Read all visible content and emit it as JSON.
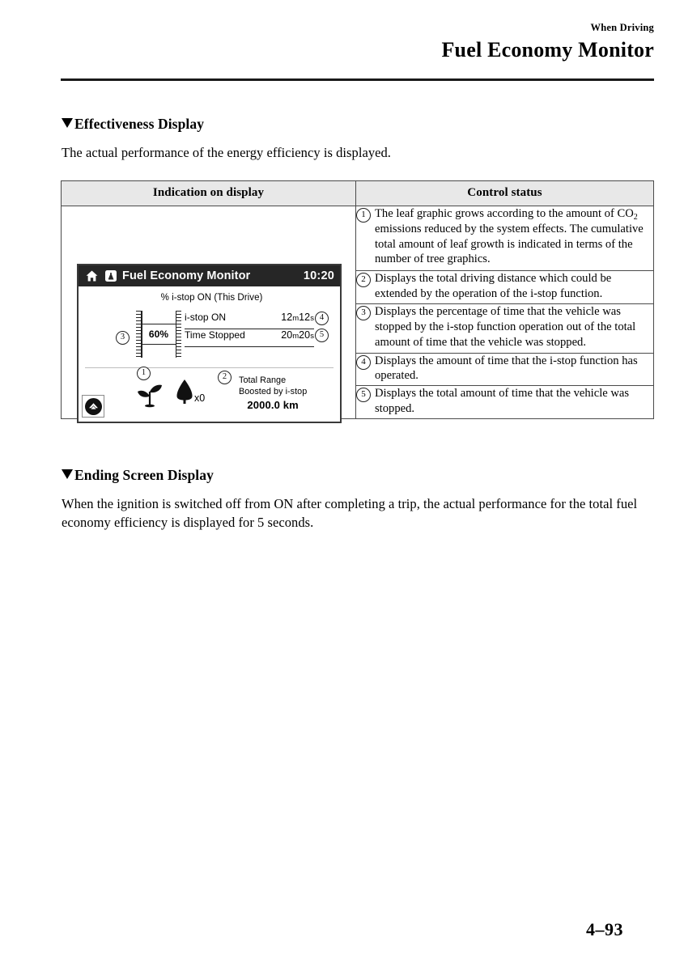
{
  "header": {
    "eyebrow": "When Driving",
    "title": "Fuel Economy Monitor"
  },
  "sections": [
    {
      "heading": "Effectiveness Display",
      "body": "The actual performance of the energy efficiency is displayed."
    },
    {
      "heading": "Ending Screen Display",
      "body": "When the ignition is switched off from ON after completing a trip, the actual performance for the total fuel economy efficiency is displayed for 5 seconds."
    }
  ],
  "table": {
    "columns": [
      "Indication on display",
      "Control status"
    ],
    "rows": [
      {
        "number": "1",
        "text_before": "The leaf graphic grows according to the amount of CO",
        "sub": "2",
        "text_after": " emissions reduced by the system effects. The cumulative total amount of leaf growth is indicated in terms of the number of tree graphics."
      },
      {
        "number": "2",
        "text": "Displays the total driving distance which could be extended by the operation of the i-stop function."
      },
      {
        "number": "3",
        "text": "Displays the percentage of time that the vehicle was stopped by the i-stop function operation out of the total amount of time that the vehicle was stopped."
      },
      {
        "number": "4",
        "text": "Displays the amount of time that the i-stop function has operated."
      },
      {
        "number": "5",
        "text": "Displays the total amount of time that the vehicle was stopped."
      }
    ]
  },
  "display": {
    "title": "Fuel Economy Monitor",
    "clock": "10:20",
    "home_icon": "home-icon",
    "media_icon": "media-source-icon",
    "caption": "% i-stop ON (This Drive)",
    "gauge": {
      "value": "60",
      "unit": "%",
      "callout": "3"
    },
    "stats": [
      {
        "label": "i-stop ON",
        "value": "12",
        "unit1": "m",
        "value2": "12",
        "unit2": "s",
        "callout": "4"
      },
      {
        "label": "Time Stopped",
        "value": "20",
        "unit1": "m",
        "value2": "20",
        "unit2": "s",
        "callout": "5"
      }
    ],
    "leaf": {
      "callout": "1",
      "sprout_icon": "sprout-icon",
      "tree_icon": "tree-icon",
      "tree_count": "x0"
    },
    "range": {
      "callout": "2",
      "line1": "Total Range",
      "line2": "Boosted by i-stop",
      "value": "2000.0 km"
    },
    "back_button": "back-up-button"
  },
  "footer": {
    "page_number": "4–93"
  },
  "colors": {
    "rule": "#1a1a1a",
    "display_header_bg": "#262626",
    "table_header_bg": "#e8e8e8",
    "table_border": "#4a4a4a"
  }
}
